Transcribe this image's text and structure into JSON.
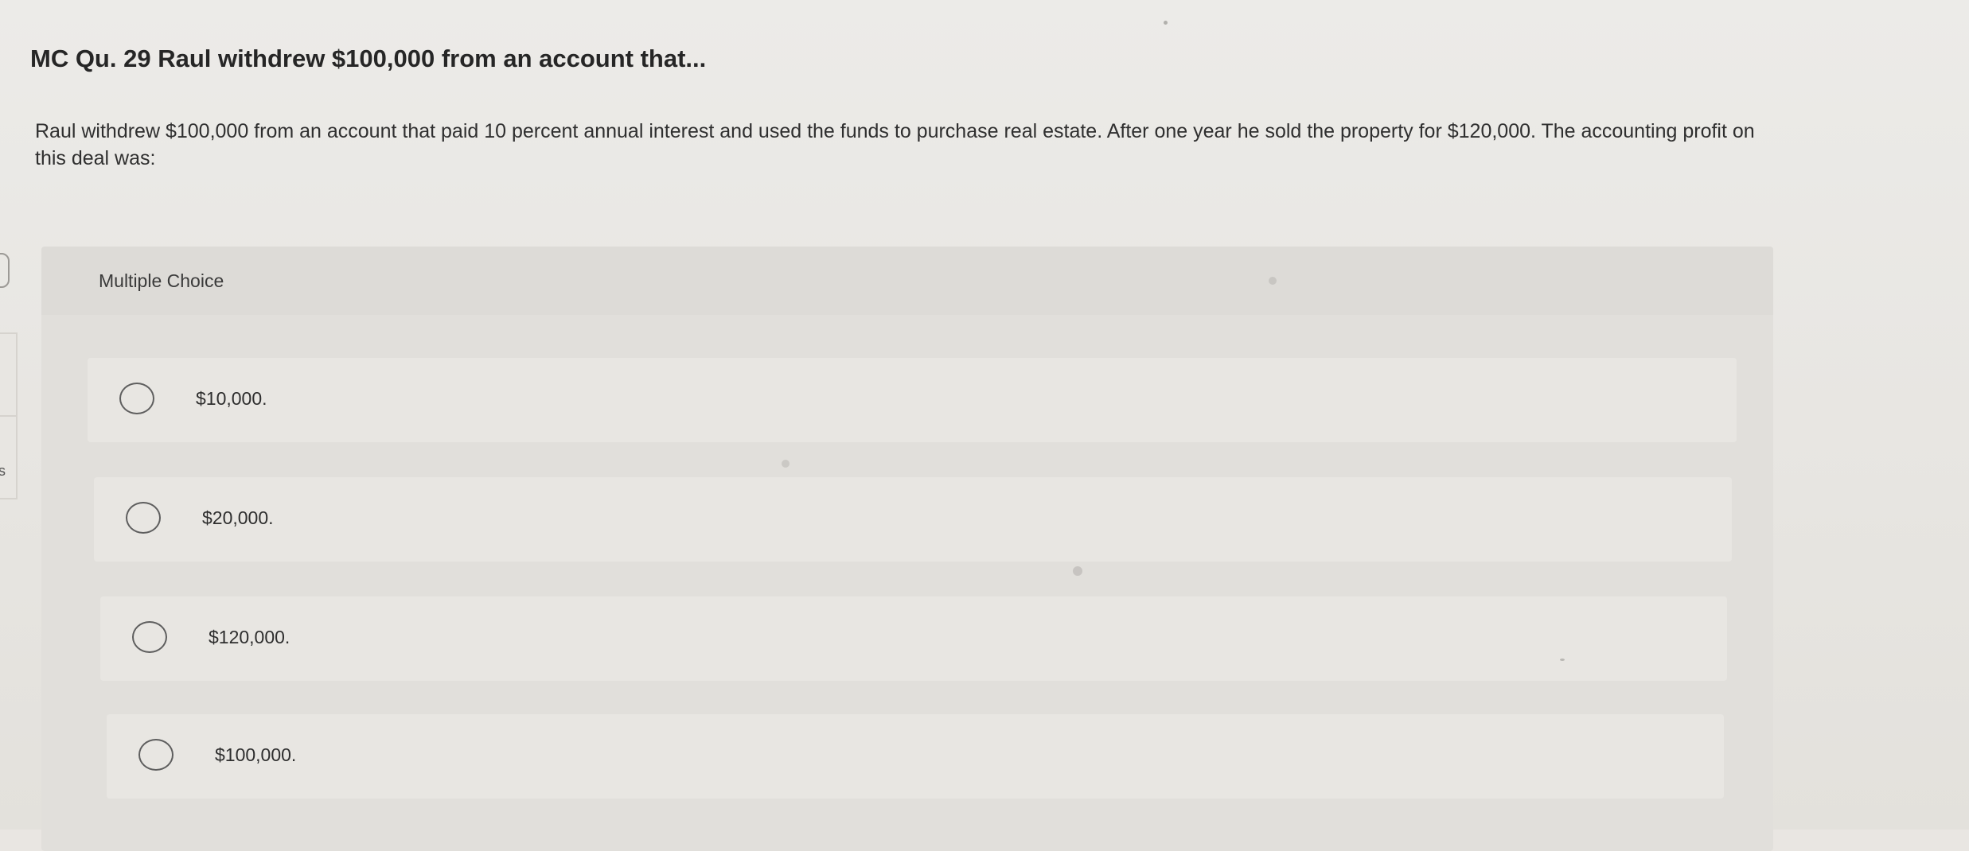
{
  "question": {
    "title": "MC Qu. 29 Raul withdrew $100,000 from an account that...",
    "text": "Raul withdrew $100,000 from an account that paid 10 percent annual interest and used the funds to purchase real estate. After one year he sold the property for $120,000. The accounting profit on this deal was:"
  },
  "multiple_choice": {
    "label": "Multiple Choice",
    "options": [
      {
        "label": "$10,000.",
        "selected": false
      },
      {
        "label": "$20,000.",
        "selected": false
      },
      {
        "label": "$120,000.",
        "selected": false
      },
      {
        "label": "$100,000.",
        "selected": false
      }
    ]
  },
  "left_edge": {
    "fragment_char": "s"
  },
  "icons": {
    "radio": "radio-unchecked-icon"
  }
}
